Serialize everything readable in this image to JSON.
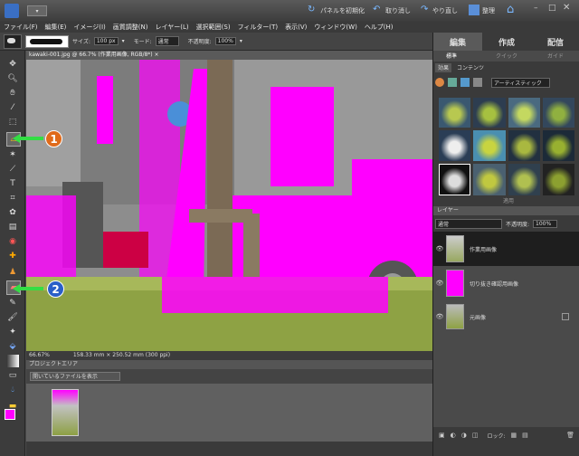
{
  "titlebar": {
    "panel_reset": "パネルを初期化",
    "undo": "取り消し",
    "redo": "やり直し",
    "organize": "整理"
  },
  "menu": [
    "ファイル(F)",
    "編集(E)",
    "イメージ(I)",
    "画質調整(N)",
    "レイヤー(L)",
    "選択範囲(S)",
    "フィルター(T)",
    "表示(V)",
    "ウィンドウ(W)",
    "ヘルプ(H)"
  ],
  "options": {
    "size_label": "サイズ:",
    "size_value": "100 px",
    "mode_label": "モード:",
    "mode_value": "通常",
    "opacity_label": "不透明度:",
    "opacity_value": "100%"
  },
  "document": {
    "tab_label": "kawaki-001.jpg @ 66.7% (作業用画像, RGB/8*) ×",
    "zoom": "66.67%",
    "dimensions": "158.33 mm × 250.52 mm (300 ppi)"
  },
  "project_bin": {
    "header": "プロジェクトエリア",
    "dropdown": "開いているファイルを表示"
  },
  "panel": {
    "tabs": [
      "編集",
      "作成",
      "配信"
    ],
    "subtabs": [
      "標準",
      "クイック",
      "ガイド"
    ],
    "effects_tabs": [
      "効果",
      "コンテンツ"
    ],
    "effects_dropdown": "アーティスティック",
    "apply_button": "適用",
    "layers_header": "レイヤー",
    "blend_mode": "通常",
    "opacity_label": "不透明度:",
    "opacity_value": "100%",
    "layers": [
      "作業用画像",
      "切り抜き確認用画像",
      "元画像"
    ],
    "lock_label": "ロック:"
  },
  "callouts": [
    "1",
    "2"
  ],
  "colors": {
    "magenta": "#ff00ff",
    "callout_orange": "#e06a1a",
    "callout_blue": "#2a5fc8",
    "arrow_green": "#33dd44"
  }
}
